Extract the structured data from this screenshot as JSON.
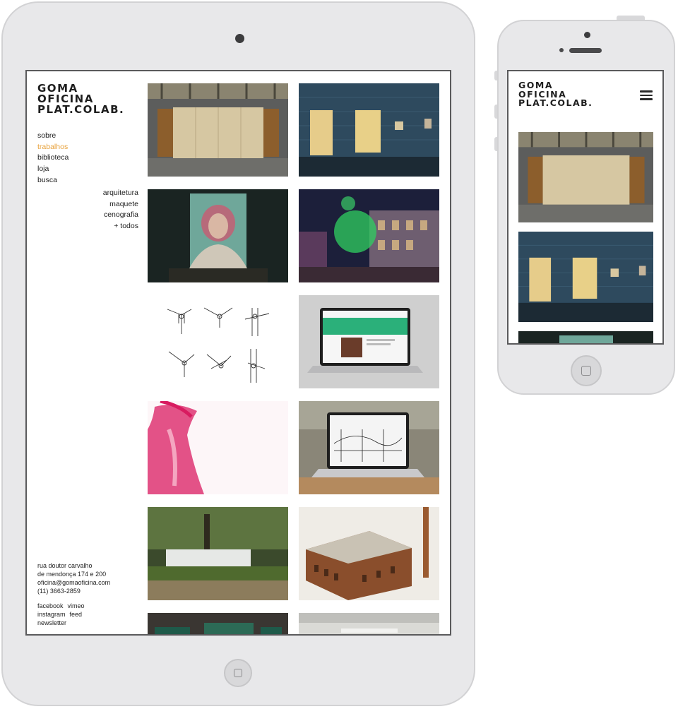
{
  "site": {
    "logo_lines": [
      "GOMA",
      "OFICINA",
      "PLAT.COLAB."
    ]
  },
  "nav": [
    {
      "label": "sobre",
      "active": false
    },
    {
      "label": "trabalhos",
      "active": true
    },
    {
      "label": "biblioteca",
      "active": false
    },
    {
      "label": "loja",
      "active": false
    },
    {
      "label": "busca",
      "active": false
    }
  ],
  "subnav": [
    "arquitetura",
    "maquete",
    "cenografia",
    "+ todos"
  ],
  "contact": {
    "lines": [
      "rua doutor carvalho",
      "de mendonça 174 e 200",
      "oficina@gomaoficina.com",
      "(11) 3663-2859"
    ]
  },
  "social": {
    "row1": [
      "facebook",
      "vimeo"
    ],
    "row2": [
      "instagram",
      "feed"
    ],
    "row3": [
      "newsletter"
    ]
  },
  "colors": {
    "accent": "#e8a23c",
    "text": "#1e1e1e",
    "device": "#e8e8ea"
  },
  "tiles": [
    {
      "name": "tile-exhibition-wall"
    },
    {
      "name": "tile-blue-facade-night"
    },
    {
      "name": "tile-pink-hair-portrait"
    },
    {
      "name": "tile-street-party-night"
    },
    {
      "name": "tile-joint-sketches"
    },
    {
      "name": "tile-laptop-green-site"
    },
    {
      "name": "tile-pink-figure"
    },
    {
      "name": "tile-laptop-drawing"
    },
    {
      "name": "tile-park-pavilion"
    },
    {
      "name": "tile-factory-model"
    },
    {
      "name": "tile-dark-room"
    },
    {
      "name": "tile-white-room"
    }
  ]
}
